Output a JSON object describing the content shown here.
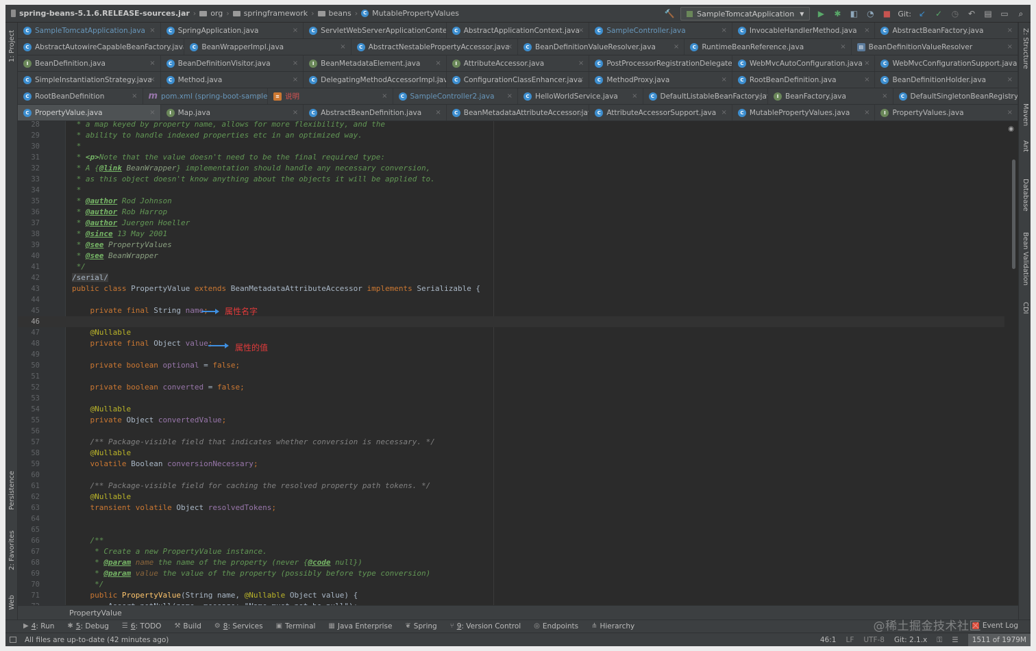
{
  "navbar": {
    "crumbs": [
      "spring-beans-5.1.6.RELEASE-sources.jar",
      "org",
      "springframework",
      "beans",
      "MutablePropertyValues"
    ],
    "run_config": "SampleTomcatApplication",
    "git_label": "Git:"
  },
  "tab_rows": [
    [
      {
        "label": "SampleTomcatApplication.java",
        "icon": "class",
        "style": "blue"
      },
      {
        "label": "SpringApplication.java",
        "icon": "class"
      },
      {
        "label": "ServletWebServerApplicationContext.java",
        "icon": "class"
      },
      {
        "label": "AbstractApplicationContext.java",
        "icon": "abstract"
      },
      {
        "label": "SampleController.java",
        "icon": "class",
        "style": "blue"
      },
      {
        "label": "InvocableHandlerMethod.java",
        "icon": "class"
      },
      {
        "label": "AbstractBeanFactory.java",
        "icon": "abstract"
      }
    ],
    [
      {
        "label": "AbstractAutowireCapableBeanFactory.java",
        "icon": "abstract"
      },
      {
        "label": "BeanWrapperImpl.java",
        "icon": "class"
      },
      {
        "label": "AbstractNestablePropertyAccessor.java",
        "icon": "abstract"
      },
      {
        "label": "BeanDefinitionValueResolver.java",
        "icon": "class"
      },
      {
        "label": "RuntimeBeanReference.java",
        "icon": "class"
      },
      {
        "label": "BeanDefinitionValueResolver",
        "icon": "struct"
      }
    ],
    [
      {
        "label": "BeanDefinition.java",
        "icon": "interface"
      },
      {
        "label": "BeanDefinitionVisitor.java",
        "icon": "class"
      },
      {
        "label": "BeanMetadataElement.java",
        "icon": "interface"
      },
      {
        "label": "AttributeAccessor.java",
        "icon": "interface"
      },
      {
        "label": "PostProcessorRegistrationDelegate.java",
        "icon": "class"
      },
      {
        "label": "WebMvcAutoConfiguration.java",
        "icon": "class"
      },
      {
        "label": "WebMvcConfigurationSupport.java",
        "icon": "class"
      }
    ],
    [
      {
        "label": "SimpleInstantiationStrategy.java",
        "icon": "class"
      },
      {
        "label": "Method.java",
        "icon": "class"
      },
      {
        "label": "DelegatingMethodAccessorImpl.java",
        "icon": "class"
      },
      {
        "label": "ConfigurationClassEnhancer.java",
        "icon": "class"
      },
      {
        "label": "MethodProxy.java",
        "icon": "class"
      },
      {
        "label": "RootBeanDefinition.java",
        "icon": "class"
      },
      {
        "label": "BeanDefinitionHolder.java",
        "icon": "class"
      }
    ],
    [
      {
        "label": "RootBeanDefinition",
        "icon": "class"
      },
      {
        "label": "pom.xml (spring-boot-sample-tomcat)",
        "icon": "maven",
        "style": "blue"
      },
      {
        "label": "说明",
        "icon": "text",
        "style": "red"
      },
      {
        "label": "SampleController2.java",
        "icon": "class",
        "style": "blue"
      },
      {
        "label": "HelloWorldService.java",
        "icon": "class"
      },
      {
        "label": "DefaultListableBeanFactory.java",
        "icon": "class"
      },
      {
        "label": "BeanFactory.java",
        "icon": "interface"
      },
      {
        "label": "DefaultSingletonBeanRegistry.java",
        "icon": "class"
      }
    ],
    [
      {
        "label": "PropertyValue.java",
        "icon": "class",
        "active": true
      },
      {
        "label": "Map.java",
        "icon": "interface"
      },
      {
        "label": "AbstractBeanDefinition.java",
        "icon": "abstract"
      },
      {
        "label": "BeanMetadataAttributeAccessor.java",
        "icon": "class"
      },
      {
        "label": "AttributeAccessorSupport.java",
        "icon": "abstract"
      },
      {
        "label": "MutablePropertyValues.java",
        "icon": "class"
      },
      {
        "label": "PropertyValues.java",
        "icon": "interface"
      }
    ]
  ],
  "left_tools": [
    "1: Project",
    "Persistence",
    "2: Favorites",
    "Web"
  ],
  "right_tools": [
    "Z: Structure",
    "Maven",
    "Ant",
    "Database",
    "Bean Validation",
    "CDI"
  ],
  "editor": {
    "first_line": 28,
    "current_line": 46,
    "lines": [
      {
        "n": 28,
        "segs": [
          [
            "cm",
            " * a map keyed by property name, allows for more flexibility, and the"
          ]
        ]
      },
      {
        "n": 29,
        "segs": [
          [
            "cm",
            " * ability to handle indexed properties etc in an optimized way."
          ]
        ]
      },
      {
        "n": 30,
        "segs": [
          [
            "cm",
            " *"
          ]
        ]
      },
      {
        "n": 31,
        "segs": [
          [
            "cm",
            " * "
          ],
          [
            "tagp",
            "<p>"
          ],
          [
            "cm",
            "Note that the value doesn't need to be the final required type:"
          ]
        ]
      },
      {
        "n": 32,
        "segs": [
          [
            "cm",
            " * A {"
          ],
          [
            "tag",
            "@link"
          ],
          [
            "cmb",
            " BeanWrapper"
          ],
          [
            "cm",
            "} implementation should handle any necessary conversion,"
          ]
        ]
      },
      {
        "n": 33,
        "segs": [
          [
            "cm",
            " * as this object doesn't know anything about the objects it will be applied to."
          ]
        ]
      },
      {
        "n": 34,
        "segs": [
          [
            "cm",
            " *"
          ]
        ]
      },
      {
        "n": 35,
        "segs": [
          [
            "cm",
            " * "
          ],
          [
            "tag",
            "@author"
          ],
          [
            "cm",
            " Rod Johnson"
          ]
        ]
      },
      {
        "n": 36,
        "segs": [
          [
            "cm",
            " * "
          ],
          [
            "tag",
            "@author"
          ],
          [
            "cm",
            " Rob Harrop"
          ]
        ]
      },
      {
        "n": 37,
        "segs": [
          [
            "cm",
            " * "
          ],
          [
            "tag",
            "@author"
          ],
          [
            "cm",
            " Juergen Hoeller"
          ]
        ]
      },
      {
        "n": 38,
        "segs": [
          [
            "cm",
            " * "
          ],
          [
            "tag",
            "@since"
          ],
          [
            "cm",
            " 13 May 2001"
          ]
        ]
      },
      {
        "n": 39,
        "segs": [
          [
            "cm",
            " * "
          ],
          [
            "tag",
            "@see"
          ],
          [
            "cmb",
            " PropertyValues"
          ]
        ]
      },
      {
        "n": 40,
        "segs": [
          [
            "cm",
            " * "
          ],
          [
            "tag",
            "@see"
          ],
          [
            "cmb",
            " BeanWrapper"
          ]
        ]
      },
      {
        "n": 41,
        "segs": [
          [
            "cm",
            " */"
          ]
        ]
      },
      {
        "n": 42,
        "segs": [
          [
            "ser",
            "/serial/"
          ]
        ]
      },
      {
        "n": 43,
        "segs": [
          [
            "kw",
            "public class "
          ],
          [
            "pl",
            "PropertyValue "
          ],
          [
            "kw",
            "extends "
          ],
          [
            "pl",
            "BeanMetadataAttributeAccessor "
          ],
          [
            "kw",
            "implements "
          ],
          [
            "pl",
            "Serializable {"
          ]
        ]
      },
      {
        "n": 44,
        "segs": []
      },
      {
        "n": 45,
        "segs": [
          [
            "pl",
            "    "
          ],
          [
            "kw",
            "private final "
          ],
          [
            "pl",
            "String "
          ],
          [
            "fld",
            "name"
          ],
          [
            "kw",
            ";"
          ]
        ]
      },
      {
        "n": 46,
        "segs": []
      },
      {
        "n": 47,
        "segs": [
          [
            "pl",
            "    "
          ],
          [
            "ann",
            "@Nullable"
          ]
        ]
      },
      {
        "n": 48,
        "segs": [
          [
            "pl",
            "    "
          ],
          [
            "kw",
            "private final "
          ],
          [
            "pl",
            "Object "
          ],
          [
            "fld",
            "value"
          ],
          [
            "kw",
            ";"
          ]
        ]
      },
      {
        "n": 49,
        "segs": []
      },
      {
        "n": 50,
        "segs": [
          [
            "pl",
            "    "
          ],
          [
            "kw",
            "private boolean "
          ],
          [
            "fld",
            "optional"
          ],
          [
            "pl",
            " = "
          ],
          [
            "kw",
            "false;"
          ]
        ]
      },
      {
        "n": 51,
        "segs": []
      },
      {
        "n": 52,
        "segs": [
          [
            "pl",
            "    "
          ],
          [
            "kw",
            "private boolean "
          ],
          [
            "fld",
            "converted"
          ],
          [
            "pl",
            " = "
          ],
          [
            "kw",
            "false;"
          ]
        ]
      },
      {
        "n": 53,
        "segs": []
      },
      {
        "n": 54,
        "segs": [
          [
            "pl",
            "    "
          ],
          [
            "ann",
            "@Nullable"
          ]
        ]
      },
      {
        "n": 55,
        "segs": [
          [
            "pl",
            "    "
          ],
          [
            "kw",
            "private "
          ],
          [
            "pl",
            "Object "
          ],
          [
            "fld",
            "convertedValue"
          ],
          [
            "kw",
            ";"
          ]
        ]
      },
      {
        "n": 56,
        "segs": []
      },
      {
        "n": 57,
        "segs": [
          [
            "pl",
            "    "
          ],
          [
            "cmt",
            "/** Package-visible field that indicates whether conversion is necessary. */"
          ]
        ]
      },
      {
        "n": 58,
        "segs": [
          [
            "pl",
            "    "
          ],
          [
            "ann",
            "@Nullable"
          ]
        ]
      },
      {
        "n": 59,
        "segs": [
          [
            "pl",
            "    "
          ],
          [
            "kw",
            "volatile "
          ],
          [
            "pl",
            "Boolean "
          ],
          [
            "fld",
            "conversionNecessary"
          ],
          [
            "kw",
            ";"
          ]
        ]
      },
      {
        "n": 60,
        "segs": []
      },
      {
        "n": 61,
        "segs": [
          [
            "pl",
            "    "
          ],
          [
            "cmt",
            "/** Package-visible field for caching the resolved property path tokens. */"
          ]
        ]
      },
      {
        "n": 62,
        "segs": [
          [
            "pl",
            "    "
          ],
          [
            "ann",
            "@Nullable"
          ]
        ]
      },
      {
        "n": 63,
        "segs": [
          [
            "pl",
            "    "
          ],
          [
            "kw",
            "transient volatile "
          ],
          [
            "pl",
            "Object "
          ],
          [
            "fld",
            "resolvedTokens"
          ],
          [
            "kw",
            ";"
          ]
        ]
      },
      {
        "n": 64,
        "segs": []
      },
      {
        "n": 65,
        "segs": []
      },
      {
        "n": 66,
        "segs": [
          [
            "pl",
            "    "
          ],
          [
            "cm",
            "/**"
          ]
        ]
      },
      {
        "n": 67,
        "segs": [
          [
            "pl",
            "    "
          ],
          [
            "cm",
            " * Create a new PropertyValue instance."
          ]
        ]
      },
      {
        "n": 68,
        "segs": [
          [
            "pl",
            "    "
          ],
          [
            "cm",
            " * "
          ],
          [
            "tag",
            "@param"
          ],
          [
            "cmp",
            " name"
          ],
          [
            "cm",
            " the name of the property (never {"
          ],
          [
            "tag",
            "@code"
          ],
          [
            "cm",
            " null})"
          ]
        ]
      },
      {
        "n": 69,
        "segs": [
          [
            "pl",
            "    "
          ],
          [
            "cm",
            " * "
          ],
          [
            "tag",
            "@param"
          ],
          [
            "cmp",
            " value"
          ],
          [
            "cm",
            " the value of the property (possibly before type conversion)"
          ]
        ]
      },
      {
        "n": 70,
        "segs": [
          [
            "pl",
            "    "
          ],
          [
            "cm",
            " */"
          ]
        ]
      },
      {
        "n": 71,
        "segs": [
          [
            "pl",
            "    "
          ],
          [
            "kw",
            "public "
          ],
          [
            "fn",
            "PropertyValue"
          ],
          [
            "pl",
            "(String name, "
          ],
          [
            "ann",
            "@Nullable "
          ],
          [
            "pl",
            "Object value) {"
          ]
        ]
      },
      {
        "n": 72,
        "segs": [
          [
            "pl",
            "        Assert.notNull(name, message: \"Name must not be null\");"
          ]
        ]
      }
    ],
    "notes": {
      "name_note": "属性名字",
      "value_note": "属性的值"
    }
  },
  "editor_breadcrumb": "PropertyValue",
  "tool_windows": [
    {
      "num": "4",
      "label": ": Run",
      "icon": "run-icon"
    },
    {
      "num": "5",
      "label": ": Debug",
      "icon": "debug-icon"
    },
    {
      "num": "6",
      "label": ": TODO",
      "icon": "todo-icon"
    },
    {
      "num": "",
      "label": "Build",
      "icon": "build-icon"
    },
    {
      "num": "8",
      "label": ": Services",
      "icon": "services-icon"
    },
    {
      "num": "",
      "label": "Terminal",
      "icon": "terminal-icon"
    },
    {
      "num": "",
      "label": "Java Enterprise",
      "icon": "java-enterprise-icon"
    },
    {
      "num": "",
      "label": "Spring",
      "icon": "spring-icon"
    },
    {
      "num": "9",
      "label": ": Version Control",
      "icon": "vcs-icon"
    },
    {
      "num": "",
      "label": "Endpoints",
      "icon": "endpoints-icon"
    },
    {
      "num": "",
      "label": "Hierarchy",
      "icon": "hierarchy-icon"
    }
  ],
  "event_log": "Event Log",
  "status": {
    "message": "All files are up-to-date (42 minutes ago)",
    "position": "46:1",
    "line_sep": "LF",
    "encoding": "UTF-8",
    "git": "Git: 2.1.x",
    "memory": "1511 of 1979M"
  },
  "watermark": "@稀土掘金技术社区"
}
